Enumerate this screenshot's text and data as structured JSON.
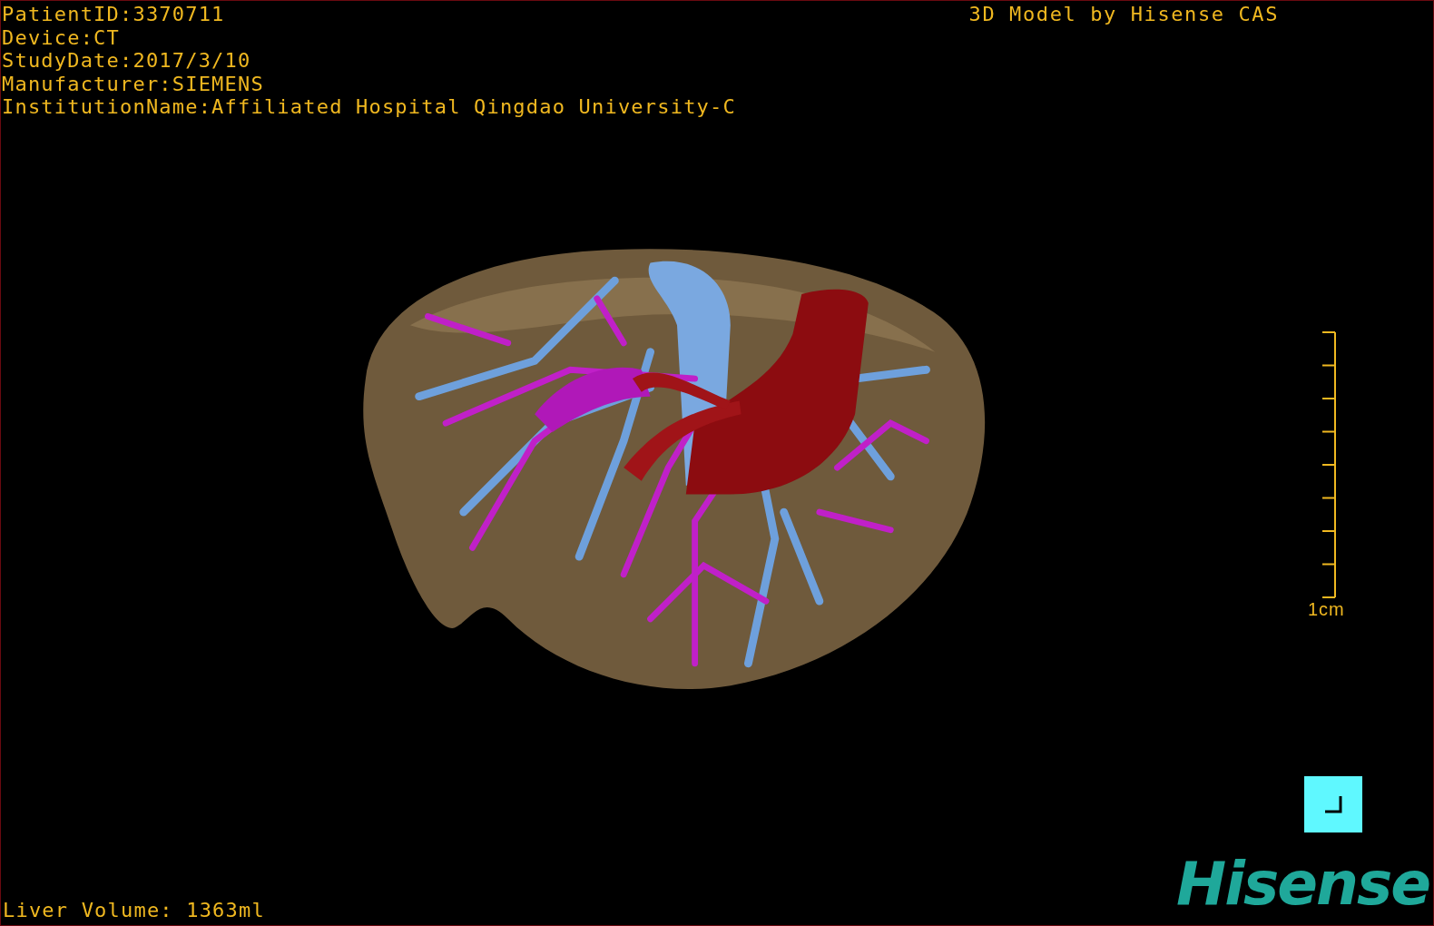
{
  "info_lines": [
    "PatientID:3370711",
    "Device:CT",
    "StudyDate:2017/3/10",
    "Manufacturer:SIEMENS",
    "InstitutionName:Affiliated Hospital Qingdao University-C"
  ],
  "title": "3D Model by Hisense CAS",
  "scale_bar": {
    "label": "1cm"
  },
  "liver_volume": "Liver Volume: 1363ml",
  "logo": "Hisense"
}
